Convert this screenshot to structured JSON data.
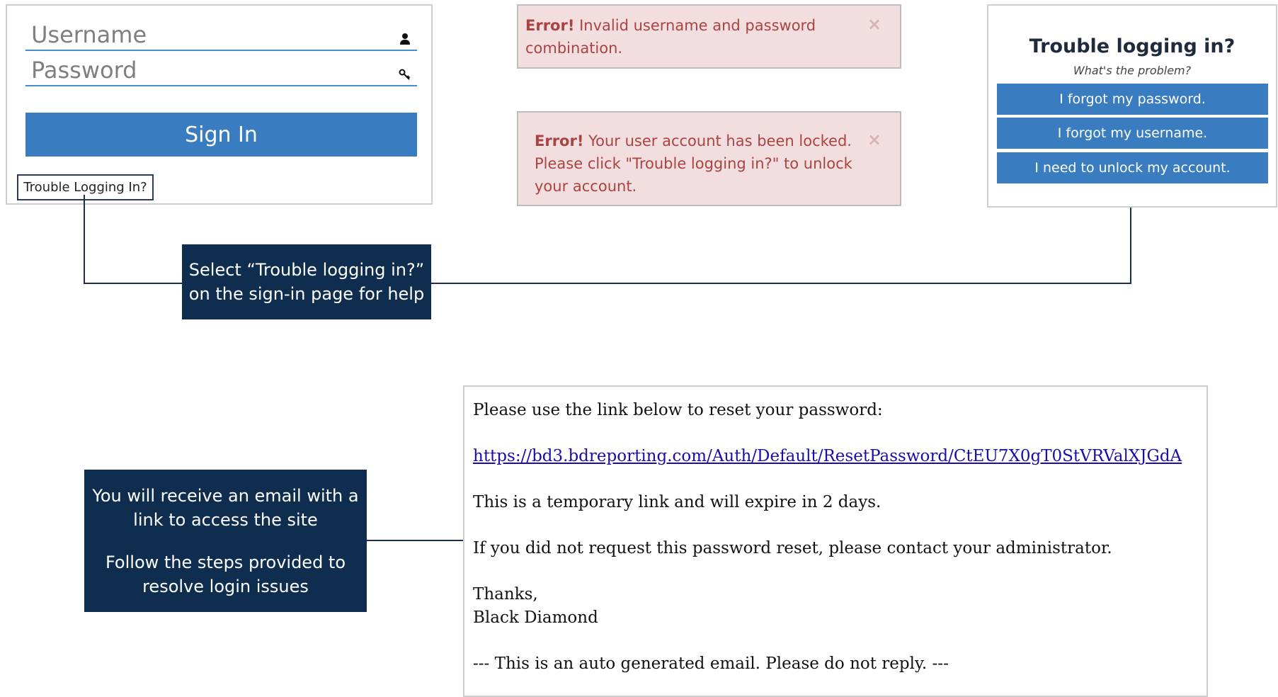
{
  "login": {
    "username_placeholder": "Username",
    "password_placeholder": "Password",
    "signin_label": "Sign In",
    "trouble_link_label": "Trouble Logging In?"
  },
  "alerts": {
    "invalid": {
      "prefix": "Error!",
      "line1": "Invalid username and password",
      "line2": "combination.",
      "close": "×"
    },
    "locked": {
      "prefix": "Error!",
      "line1": "Your user account has been locked.",
      "line2": "Please click \"Trouble logging in?\" to unlock",
      "line3": "your account.",
      "close": "×"
    }
  },
  "trouble": {
    "title": "Trouble logging in?",
    "subtitle": "What's the problem?",
    "options": [
      "I forgot my password.",
      "I forgot my username.",
      "I need to unlock my account."
    ]
  },
  "callouts": {
    "select": {
      "line1": "Select “Trouble logging in?”",
      "line2": "on the sign-in page for help"
    },
    "email": {
      "line1": "You will receive an email with a",
      "line2": "link to access the site",
      "line3": "Follow the steps provided to",
      "line4": "resolve login issues"
    }
  },
  "email": {
    "intro": "Please use the link below to reset your password:",
    "link": "https://bd3.bdreporting.com/Auth/Default/ResetPassword/CtEU7X0gT0StVRValXJGdA",
    "expiry": "This is a temporary link and will expire in 2 days.",
    "contact": "If you did not request this password reset, please contact your administrator.",
    "thanks": "Thanks,",
    "signature": "Black Diamond",
    "footer": "--- This is an auto generated email.  Please do not reply. ---"
  },
  "colors": {
    "primary_button": "#3a7cc0",
    "callout_bg": "#0f2d4e",
    "alert_bg": "#f2dede",
    "alert_text": "#a94442",
    "link": "#1a0dab"
  }
}
